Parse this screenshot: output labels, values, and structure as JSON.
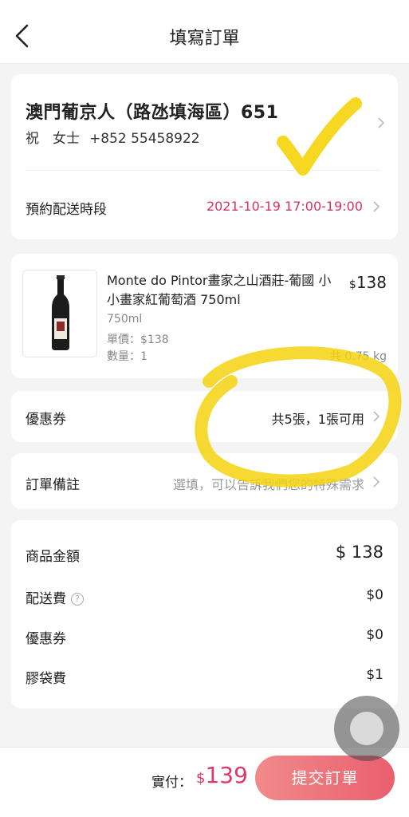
{
  "header": {
    "title": "填寫訂單"
  },
  "address": {
    "name": "澳門葡京人（路氹填海區）651",
    "recipient": "祝　女士",
    "phone": "+852 55458922"
  },
  "schedule": {
    "label": "預約配送時段",
    "value": "2021-10-19 17:00-19:00"
  },
  "product": {
    "name": "Monte do Pintor畫家之山酒莊-葡國 小小畫家紅葡萄酒 750ml",
    "price_symbol": "$",
    "price": "138",
    "spec": "750ml",
    "unit_price": "單價：$138",
    "quantity": "數量：1",
    "weight": "共 0.75 kg"
  },
  "coupon": {
    "label": "優惠券",
    "value": "共5張，1張可用"
  },
  "note": {
    "label": "訂單備註",
    "placeholder": "選填，可以告訴我們您的特殊需求"
  },
  "summary": {
    "goods_label": "商品金額",
    "goods_value": "$ 138",
    "delivery_label": "配送費",
    "delivery_value": "$0",
    "coupon_label": "優惠券",
    "coupon_value": "$0",
    "bag_label": "膠袋費",
    "bag_value": "$1"
  },
  "footer": {
    "pay_label": "實付：",
    "pay_symbol": "$",
    "pay_amount": "139",
    "submit_label": "提交訂單"
  },
  "colors": {
    "accent": "#e0366a",
    "button_start": "#f08a8a",
    "button_end": "#ea5f6e",
    "highlight": "#f5d40f"
  }
}
